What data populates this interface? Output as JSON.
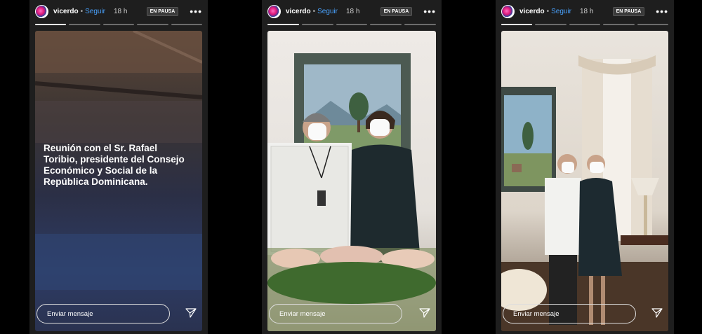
{
  "stories": [
    {
      "username": "vicerdo",
      "separator": "•",
      "follow_label": "Seguir",
      "time": "18 h",
      "status_badge": "EN PAUSA",
      "more_icon": "more-options-icon",
      "caption": "Reunión con el Sr. Rafael Toribio, presidente del Consejo Económico y Social de la República Dominicana.",
      "message_placeholder": "Enviar mensaje",
      "progress": {
        "segments": 5,
        "completed": 1
      }
    },
    {
      "username": "vicerdo",
      "separator": "•",
      "follow_label": "Seguir",
      "time": "18 h",
      "status_badge": "EN PAUSA",
      "more_icon": "more-options-icon",
      "message_placeholder": "Enviar mensaje",
      "progress": {
        "segments": 5,
        "completed": 1
      }
    },
    {
      "username": "vicerdo",
      "separator": "•",
      "follow_label": "Seguir",
      "time": "18 h",
      "status_badge": "EN PAUSA",
      "more_icon": "more-options-icon",
      "message_placeholder": "Enviar mensaje",
      "progress": {
        "segments": 5,
        "completed": 1
      }
    }
  ],
  "colors": {
    "follow": "#4aa3ff",
    "background": "#000000",
    "panel": "#1e1e1e"
  }
}
